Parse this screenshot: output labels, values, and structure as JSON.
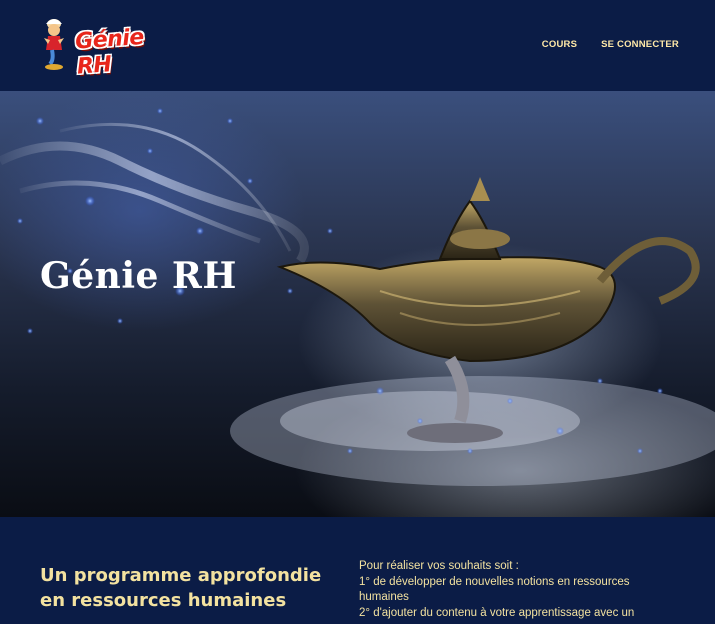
{
  "header": {
    "logo_text": "Génie RH",
    "nav": [
      {
        "label": "COURS"
      },
      {
        "label": "SE CONNECTER"
      }
    ]
  },
  "hero": {
    "title": "Génie RH",
    "image": "magic-lamp-with-smoke"
  },
  "intro": {
    "heading": "Un programme approfondie en ressources humaines",
    "body_lines": [
      "Pour réaliser vos souhaits soit :",
      "1° de développer de nouvelles notions en ressources humaines",
      "2° d'ajouter du contenu à votre apprentissage avec un"
    ]
  },
  "colors": {
    "navy": "#0b1c46",
    "accent_gold": "#f3e2a0",
    "logo_red": "#e8261b"
  }
}
